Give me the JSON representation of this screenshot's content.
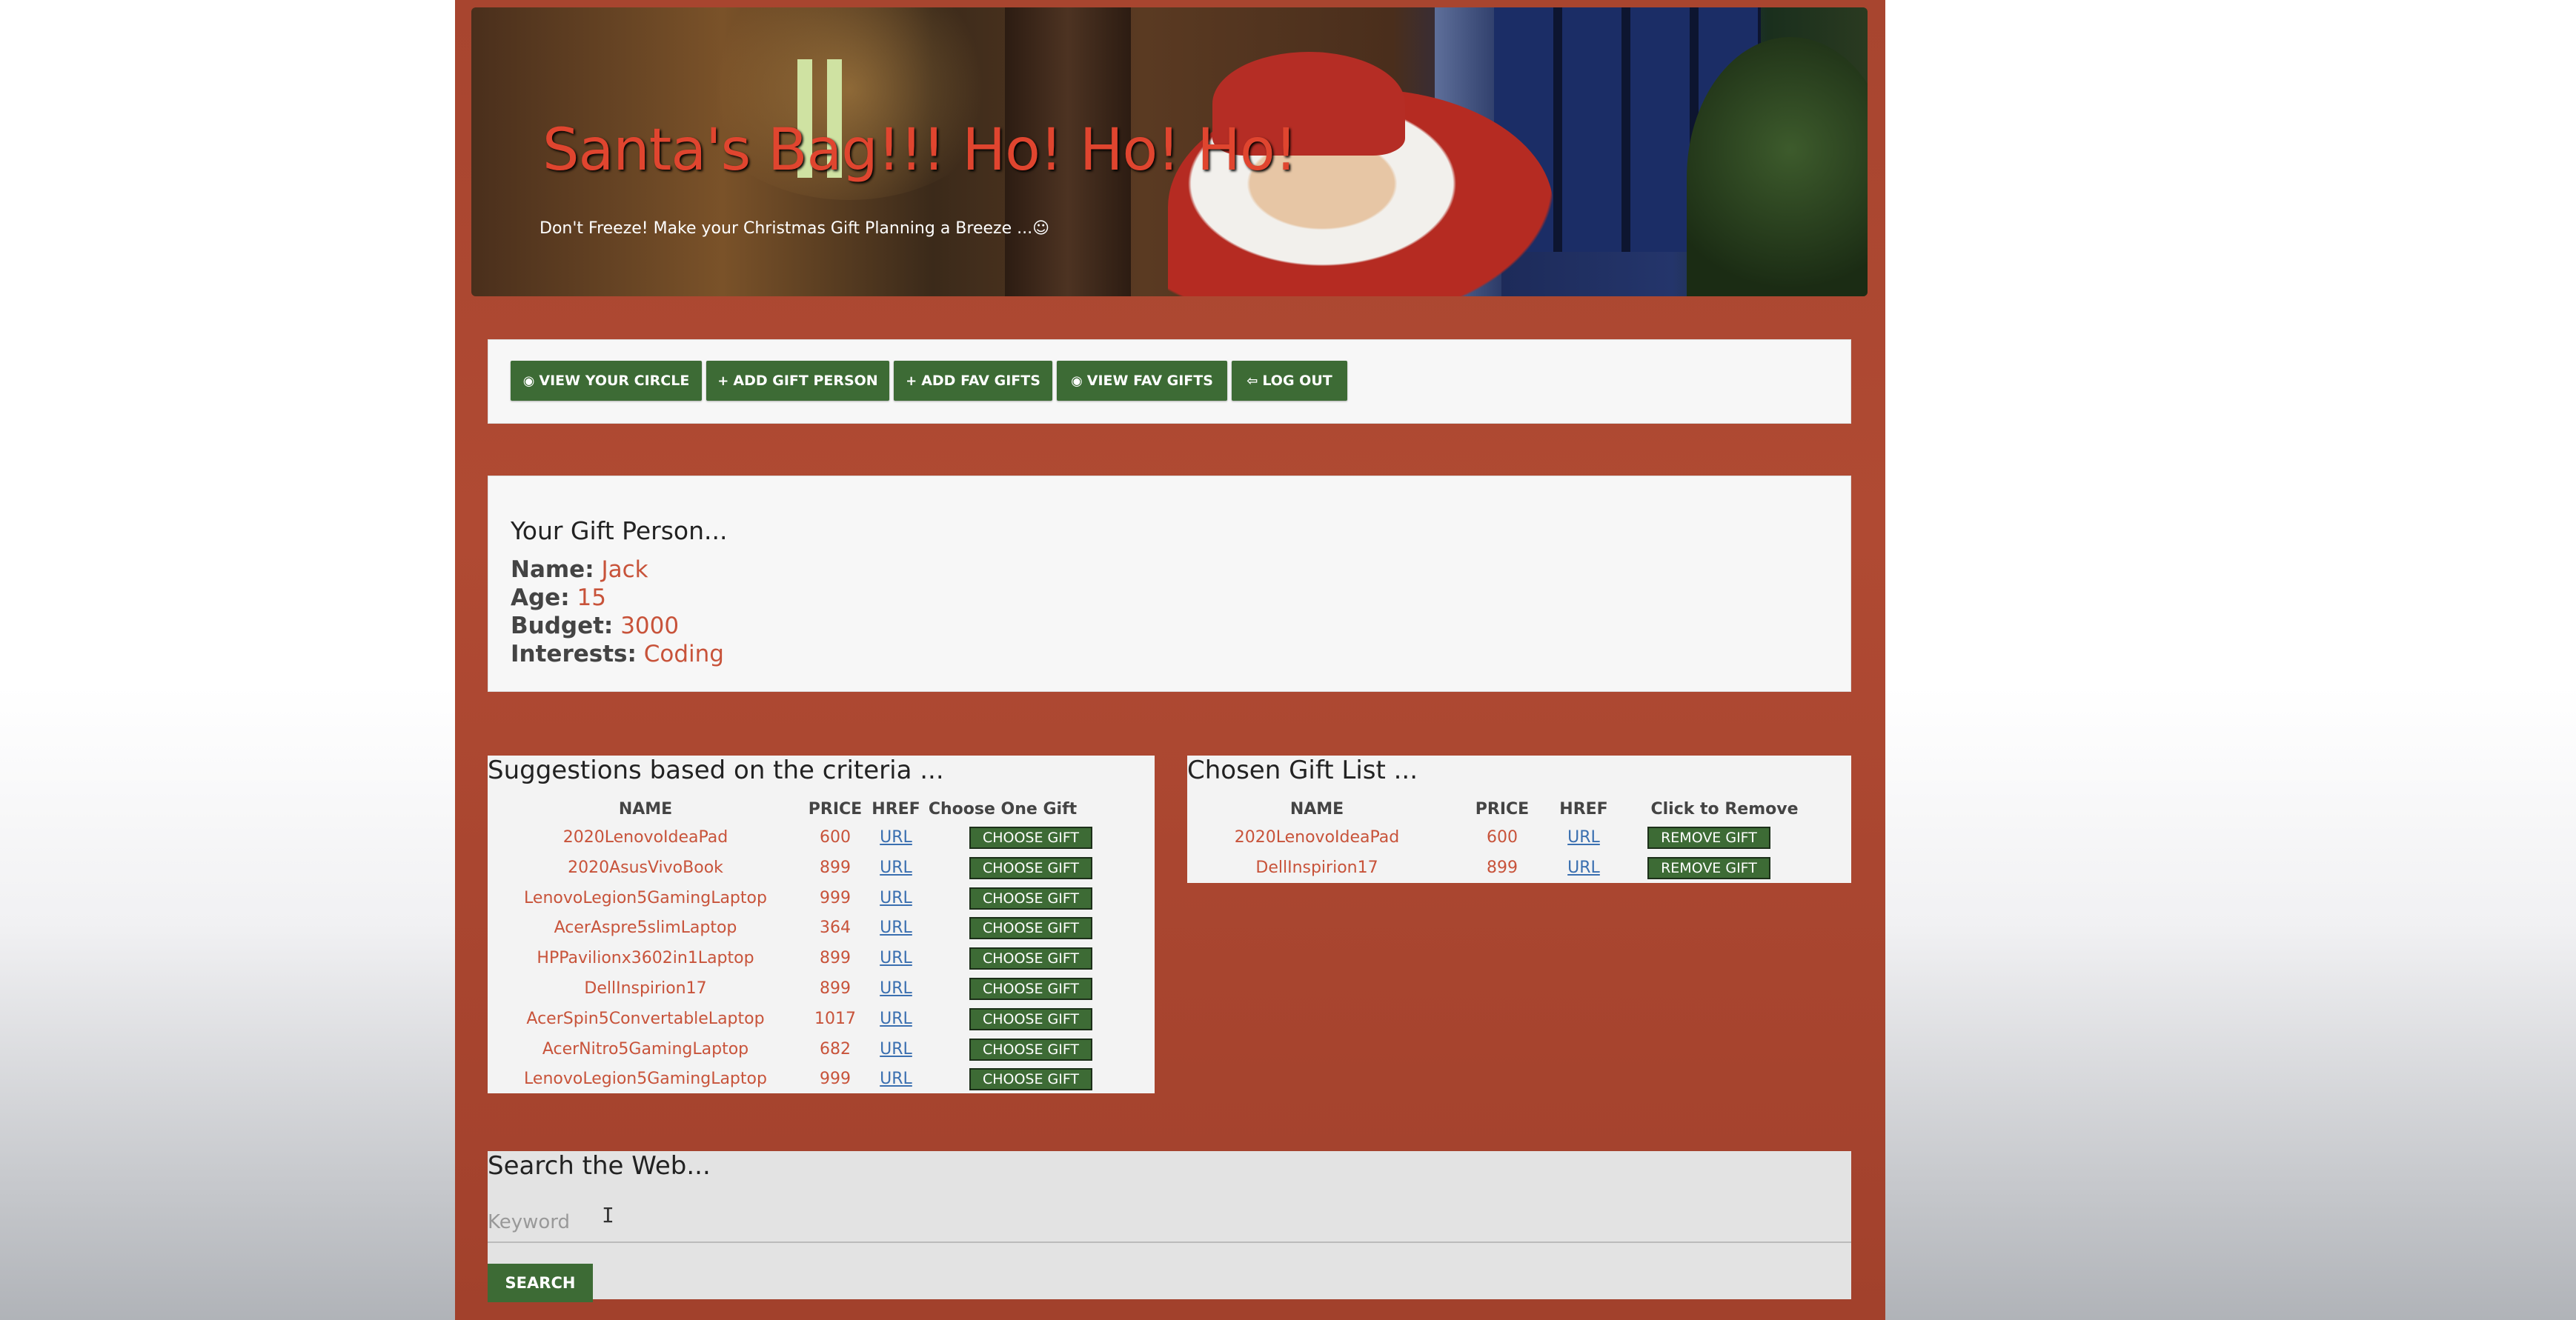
{
  "header": {
    "title": "Santa's Bag!!! Ho! Ho! Ho!",
    "subtitle": "Don't Freeze! Make your Christmas Gift Planning a Breeze ...☺"
  },
  "nav": {
    "buttons": [
      {
        "icon": "eye-icon",
        "glyph": "◉",
        "label": "VIEW YOUR CIRCLE"
      },
      {
        "icon": "plus-icon",
        "glyph": "+",
        "label": "ADD GIFT PERSON"
      },
      {
        "icon": "plus-icon",
        "glyph": "+",
        "label": "ADD FAV GIFTS"
      },
      {
        "icon": "eye-icon",
        "glyph": "◉",
        "label": "VIEW FAV GIFTS"
      },
      {
        "icon": "logout-icon",
        "glyph": "⇦",
        "label": "LOG OUT"
      }
    ]
  },
  "person": {
    "heading": "Your Gift Person...",
    "name_label": "Name:",
    "name": "Jack",
    "age_label": "Age:",
    "age": "15",
    "budget_label": "Budget:",
    "budget": "3000",
    "interests_label": "Interests:",
    "interests": "Coding"
  },
  "suggestions": {
    "heading": "Suggestions based on the criteria ...",
    "columns": [
      "NAME",
      "PRICE",
      "HREF",
      "Choose One Gift"
    ],
    "button_label": "CHOOSE GIFT",
    "rows": [
      {
        "name": "2020LenovoIdeaPad",
        "price": "600",
        "href": "URL"
      },
      {
        "name": "2020AsusVivoBook",
        "price": "899",
        "href": "URL"
      },
      {
        "name": "LenovoLegion5GamingLaptop",
        "price": "999",
        "href": "URL"
      },
      {
        "name": "AcerAspre5slimLaptop",
        "price": "364",
        "href": "URL"
      },
      {
        "name": "HPPavilionx3602in1Laptop",
        "price": "899",
        "href": "URL"
      },
      {
        "name": "DellInspirion17",
        "price": "899",
        "href": "URL"
      },
      {
        "name": "AcerSpin5ConvertableLaptop",
        "price": "1017",
        "href": "URL"
      },
      {
        "name": "AcerNitro5GamingLaptop",
        "price": "682",
        "href": "URL"
      },
      {
        "name": "LenovoLegion5GamingLaptop",
        "price": "999",
        "href": "URL"
      }
    ]
  },
  "chosen": {
    "heading": "Chosen Gift List ...",
    "columns": [
      "NAME",
      "PRICE",
      "HREF",
      "Click to Remove"
    ],
    "button_label": "REMOVE GIFT",
    "rows": [
      {
        "name": "2020LenovoIdeaPad",
        "price": "600",
        "href": "URL"
      },
      {
        "name": "DellInspirion17",
        "price": "899",
        "href": "URL"
      }
    ]
  },
  "search": {
    "heading": "Search the Web...",
    "placeholder": "Keyword",
    "button_label": "SEARCH"
  },
  "colors": {
    "page_background": "#a8452f",
    "button_green": "#3d6b35",
    "value_text": "#c8533a",
    "link": "#3a6fb0"
  }
}
